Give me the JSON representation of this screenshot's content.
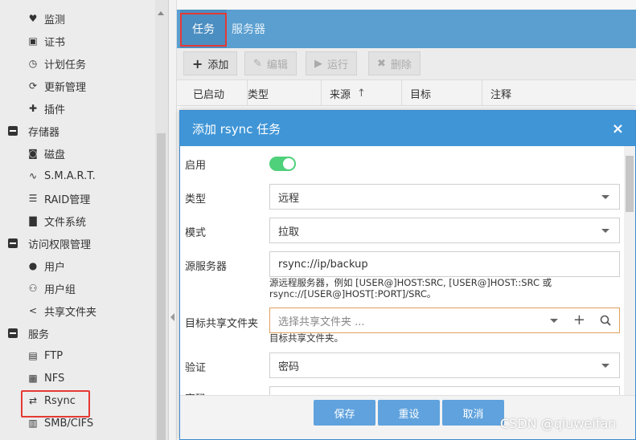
{
  "sidebar": {
    "items": [
      {
        "label": "监测",
        "icon": "heart-pulse-icon",
        "type": "sub"
      },
      {
        "label": "证书",
        "icon": "certificate-icon",
        "type": "sub"
      },
      {
        "label": "计划任务",
        "icon": "calendar-clock-icon",
        "type": "sub"
      },
      {
        "label": "更新管理",
        "icon": "refresh-icon",
        "type": "sub"
      },
      {
        "label": "插件",
        "icon": "puzzle-icon",
        "type": "sub"
      },
      {
        "label": "存储器",
        "icon": "collapse-icon",
        "type": "group"
      },
      {
        "label": "磁盘",
        "icon": "disk-icon",
        "type": "sub"
      },
      {
        "label": "S.M.A.R.T.",
        "icon": "pulse-icon",
        "type": "sub"
      },
      {
        "label": "RAID管理",
        "icon": "database-icon",
        "type": "sub"
      },
      {
        "label": "文件系统",
        "icon": "folders-icon",
        "type": "sub"
      },
      {
        "label": "访问权限管理",
        "icon": "collapse-icon",
        "type": "group"
      },
      {
        "label": "用户",
        "icon": "user-icon",
        "type": "sub"
      },
      {
        "label": "用户组",
        "icon": "users-icon",
        "type": "sub"
      },
      {
        "label": "共享文件夹",
        "icon": "share-icon",
        "type": "sub"
      },
      {
        "label": "服务",
        "icon": "collapse-icon",
        "type": "group"
      },
      {
        "label": "FTP",
        "icon": "server-icon",
        "type": "sub"
      },
      {
        "label": "NFS",
        "icon": "network-drive-icon",
        "type": "sub"
      },
      {
        "label": "Rsync",
        "icon": "rsync-icon",
        "type": "sub"
      },
      {
        "label": "SMB/CIFS",
        "icon": "smb-icon",
        "type": "sub"
      }
    ]
  },
  "tabs": [
    {
      "label": "任务",
      "active": true
    },
    {
      "label": "服务器",
      "active": false
    }
  ],
  "toolbar": {
    "add": "添加",
    "edit": "编辑",
    "run": "运行",
    "delete": "删除"
  },
  "grid": {
    "columns": [
      "已启动",
      "类型",
      "来源",
      "目标",
      "注释"
    ],
    "sort_indicator": "↑"
  },
  "dialog": {
    "title": "添加 rsync 任务",
    "close": "×",
    "fields": {
      "enable_label": "启用",
      "enable_value": true,
      "type_label": "类型",
      "type_value": "远程",
      "mode_label": "模式",
      "mode_value": "拉取",
      "source_label": "源服务器",
      "source_value": "rsync://ip/backup",
      "source_hint_1": "源远程服务器，例如 [USER@]HOST:SRC, [USER@]HOST::SRC 或",
      "source_hint_2": "rsync://[USER@]HOST[:PORT]/SRC。",
      "target_label": "目标共享文件夹",
      "target_placeholder": "选择共享文件夹 ...",
      "target_hint": "目标共享文件夹。",
      "auth_label": "验证",
      "auth_value": "密码",
      "password_label_partial": "密码"
    },
    "buttons": {
      "save": "保存",
      "reset": "重设",
      "cancel": "取消"
    }
  },
  "watermark": "CSDN @qiuweifan",
  "colors": {
    "tabbar": "#5a9fd0",
    "dialog_header": "#3f95d6",
    "button": "#5fa2dd",
    "toggle_on": "#4fd07a",
    "highlight": "#e53935"
  }
}
